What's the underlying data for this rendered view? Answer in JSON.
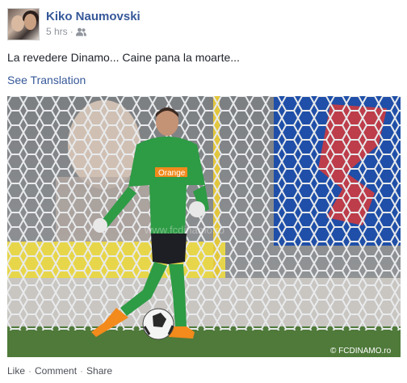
{
  "post": {
    "author": "Kiko Naumovski",
    "time": "5 hrs",
    "audience_icon": "friends-icon",
    "text": "La revedere Dinamo... Caine pana la moarte...",
    "see_translation": "See Translation",
    "photo": {
      "jersey_sponsor": "Orange",
      "watermark": "© FCDINAMO.ro",
      "center_watermark": "www.fcdinamo.ro"
    }
  },
  "actions": {
    "like": "Like",
    "comment": "Comment",
    "share": "Share",
    "separator": "·"
  },
  "colors": {
    "link_blue": "#365899",
    "meta_gray": "#90949c",
    "jersey_green": "#2e9b45",
    "stand_blue": "#1f4fa8"
  }
}
